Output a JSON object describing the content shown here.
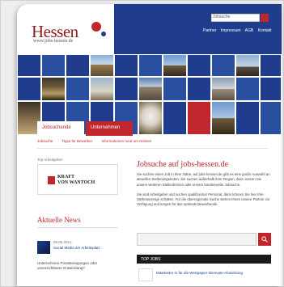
{
  "header": {
    "logo_text": "Hessen",
    "logo_url": "www.jobs-hessen.de",
    "search_placeholder": "Jobsuche",
    "top_links": [
      "Partner",
      "Impressum",
      "AGB",
      "Kontakt"
    ]
  },
  "tabs": [
    {
      "label": "Jobsuchende",
      "active": true
    },
    {
      "label": "Unternehmen",
      "active": false
    }
  ],
  "subnav": [
    "Jobsuche",
    "Tipps für Bewerber",
    "Informationen rund um Hessen"
  ],
  "partner": {
    "label": "Top Arbeitgeber",
    "name_line1": "KRAFT",
    "name_line2": "VON WANTOCH"
  },
  "news": {
    "title": "Aktuelle News",
    "date": "05.06.2012",
    "link": "Social Media am Arbeitsplatz",
    "teaser": "Unternehmen Privatanregungen oder unverzichtbarer Entwicklung?"
  },
  "main": {
    "title": "Jobsuche auf jobs-hessen.de",
    "para1": "Sie suchen einen Job in Ihrer Nähe, auf jobs-hessen.de gibt es eine große Auswahl an aktuellen Stellenangeboten. Sie suchen außerhalb ihrer Region, dann nutzen Sie unsere weiteren Stellenbörsen oder unsere bundesweite Jobsuche.",
    "para2": "Sie sind Arbeitgeber und suchen qualifiziertes Personal, dann können Sie hier Ihre Stellenanzeige schalten. Für die überregionale Suche stehen Ihnen unsere Partner zur Verfügung und sorgen für das optimale Bewerbende.",
    "link1": "Stellenbörsen",
    "link2": "Stellenanzeige schalten",
    "link3": "Partner"
  },
  "top_jobs": {
    "title": "TOP JOBS",
    "item": "Mitarbeiter m für die Wertpapier-/Derivate-Abwicklung"
  },
  "colors": {
    "brand_blue": "#1f3d8c",
    "brand_red": "#c0272d"
  }
}
